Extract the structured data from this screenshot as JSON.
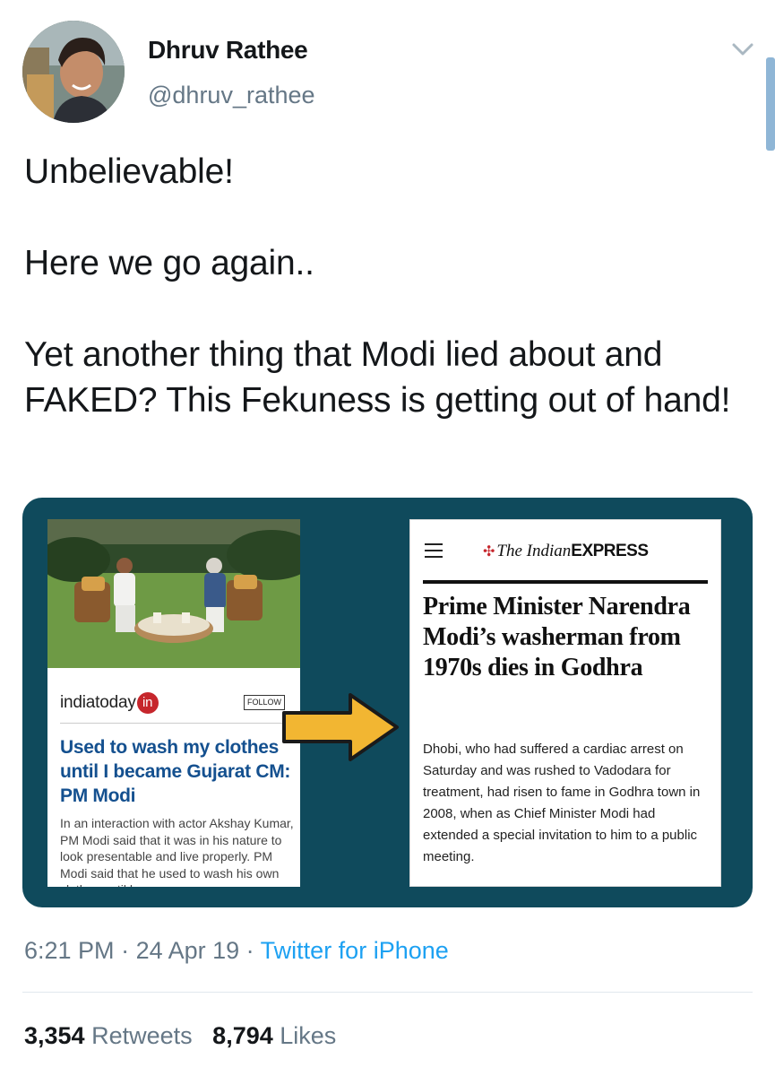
{
  "author": {
    "display_name": "Dhruv Rathee",
    "handle": "@dhruv_rathee"
  },
  "tweet": {
    "text": "Unbelievable!\n\nHere we go again..\n\nYet another thing that Modi lied about and FAKED? This Fekuness is getting out of hand!"
  },
  "media": {
    "left": {
      "brand": "indiatoday",
      "brand_badge": "in",
      "follow_label": "FOLLOW",
      "headline": "Used to wash my clothes until I became Gujarat CM: PM Modi",
      "body": "In an interaction with actor Akshay Kumar, PM Modi said that it was in his nature to look presentable and live properly. PM Modi said that he used to wash his own clothes until he"
    },
    "right": {
      "logo_italic": "The Indian",
      "logo_caps": "EXPRESS",
      "headline": "Prime Minister Narendra Modi’s washerman from 1970s dies in Godhra",
      "body": "Dhobi, who had suffered a cardiac arrest on Saturday and was rushed to Vadodara for treatment, had risen to fame in Godhra town in 2008, when as Chief Minister Modi had extended a special invitation to him to a public meeting."
    }
  },
  "meta": {
    "time": "6:21 PM",
    "separator": " · ",
    "date": "24 Apr 19",
    "source": "Twitter for iPhone"
  },
  "stats": {
    "retweets_count": "3,354",
    "retweets_label": "Retweets",
    "likes_count": "8,794",
    "likes_label": "Likes"
  },
  "colors": {
    "link_blue": "#1da1f2",
    "muted_gray": "#657786",
    "media_background": "#0f4a5c",
    "arrow_yellow": "#f2b632",
    "india_today_red": "#c6262c",
    "headline_blue": "#14508f"
  },
  "icons": {
    "caret": "chevron-down-icon",
    "menu": "hamburger-icon",
    "arrow": "arrow-right-icon"
  }
}
